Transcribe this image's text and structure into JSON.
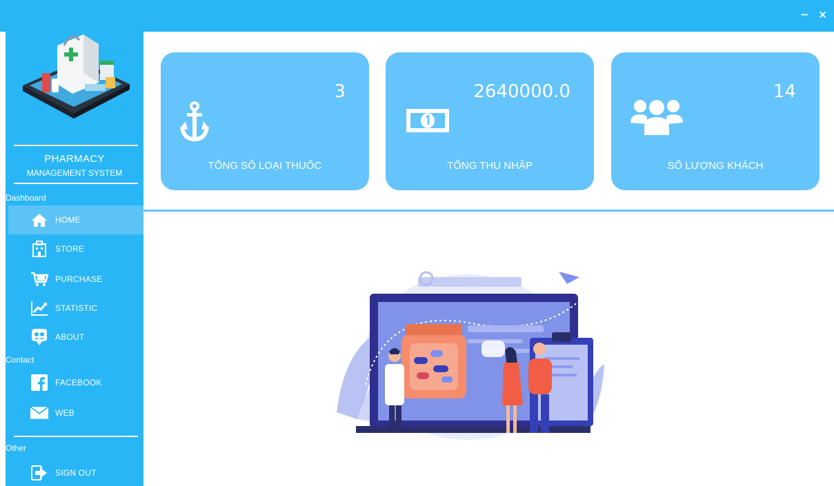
{
  "window": {
    "minimize_label": "−",
    "close_label": "×"
  },
  "sidebar": {
    "brand_line1": "PHARMACY",
    "brand_line2": "MANAGEMENT SYSTEM",
    "sections": [
      {
        "label": "Dashboard"
      },
      {
        "label": "Contact"
      },
      {
        "label": "Other"
      }
    ],
    "items": [
      {
        "label": "HOME",
        "icon": "home-icon",
        "active": true
      },
      {
        "label": "STORE",
        "icon": "store-icon",
        "active": false
      },
      {
        "label": "PURCHASE",
        "icon": "cart-icon",
        "active": false
      },
      {
        "label": "STATISTIC",
        "icon": "chart-icon",
        "active": false
      },
      {
        "label": "ABOUT",
        "icon": "about-icon",
        "active": false
      },
      {
        "label": "FACEBOOK",
        "icon": "facebook-icon",
        "active": false
      },
      {
        "label": "WEB",
        "icon": "mail-icon",
        "active": false
      },
      {
        "label": "SIGN OUT",
        "icon": "sign-out-icon",
        "active": false
      }
    ]
  },
  "cards": [
    {
      "value": "3",
      "label": "TỔNG SỐ LOẠI THUỐC",
      "icon": "anchor-icon"
    },
    {
      "value": "2640000.0",
      "label": "TỔNG THU NHẬP",
      "icon": "money-icon"
    },
    {
      "value": "14",
      "label": "SỐ LƯỢNG KHÁCH",
      "icon": "users-icon"
    }
  ],
  "colors": {
    "sidebar": "#29b6f6",
    "card": "#64c4fb",
    "active_item": "#5bc3f5"
  }
}
